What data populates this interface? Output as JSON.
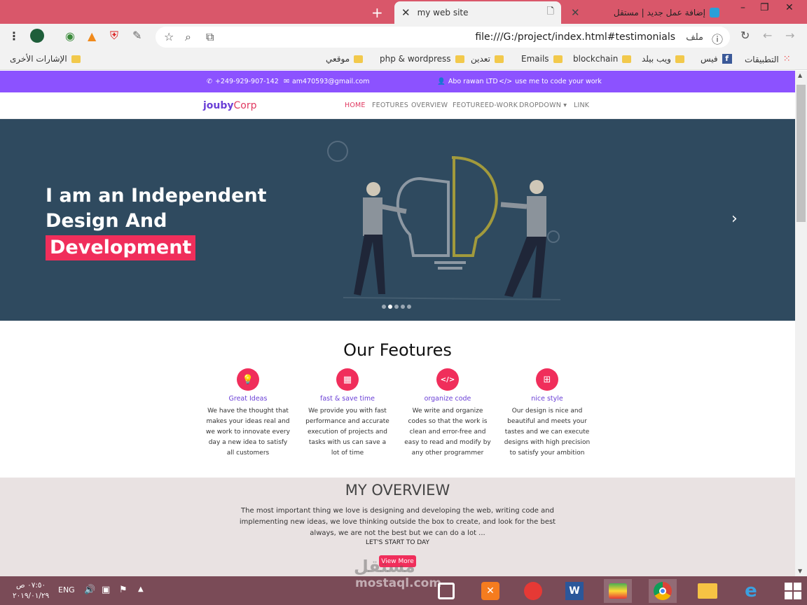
{
  "browser": {
    "new_tab_symbol": "+",
    "tabs": [
      {
        "title": "my web site",
        "close": "✕"
      },
      {
        "title": "إضافة عمل جديد | مستقل",
        "close": "✕"
      }
    ],
    "url": "file:///G:/project/index.html#testimonials",
    "url_label": "ملف",
    "window_controls": [
      "–",
      "❐",
      "✕"
    ]
  },
  "bookmarks": {
    "apps": "التطبيقات",
    "items": [
      "فيس",
      "ويب بيلد",
      "blockchain",
      "Emails",
      "تعدين",
      "php & wordpress",
      "موقعي"
    ],
    "other": "الإشارات الأخرى"
  },
  "site": {
    "topbar": {
      "phone": "+249-929-907-142",
      "email": "am470593@gmail.com",
      "company": "Abo rawan LTD",
      "cta": "use me to code your work"
    },
    "logo_a": "jouby",
    "logo_b": "Corp",
    "nav": [
      "HOME",
      "FEOTURES",
      "OVERVIEW",
      "FEOTUREED-WORK",
      "DROPDOWN ▾",
      "LINK"
    ],
    "hero": {
      "line1": "I am an Independent",
      "line2": "Design And",
      "highlight": "Development",
      "next_arrow": "›"
    },
    "features": {
      "title": "Our Feotures",
      "items": [
        {
          "title": "Great Ideas",
          "text": "We have the thought that makes your ideas real and we work to innovate every day a new idea to satisfy all customers",
          "icon": "lightbulb-icon",
          "glyph": "💡"
        },
        {
          "title": "fast & save time",
          "text": "We provide you with fast performance and accurate execution of projects and tasks with us can save a lot of time",
          "icon": "calendar-icon",
          "glyph": "▦"
        },
        {
          "title": "organize code",
          "text": "We write and organize codes so that the work is clean and error-free and easy to read and modify by any other programmer",
          "icon": "code-icon",
          "glyph": "</>"
        },
        {
          "title": "nice style",
          "text": "Our design is nice and beautiful and meets your tastes and we can execute designs with high precision to satisfy your ambition",
          "icon": "sitemap-icon",
          "glyph": "⊞"
        }
      ]
    },
    "overview": {
      "title": "MY OVERVIEW",
      "text": "The most important thing we love is designing and developing the web, writing code and implementing new ideas, we love thinking outside the box to create, and look for the best always, we are not the best but we can do a lot ...",
      "sub": "LET'S START TO DAY",
      "button": "View More"
    }
  },
  "taskbar": {
    "time": "٠٧:٥٠ ص",
    "date": "٢٠١٩/٠١/٢٩",
    "lang": "ENG"
  },
  "watermark": {
    "ar": "مستقل",
    "en": "mostaql.com"
  },
  "colors": {
    "accent": "#8c52ff",
    "pink": "#f02e5b",
    "hero": "#2f4a5f"
  }
}
